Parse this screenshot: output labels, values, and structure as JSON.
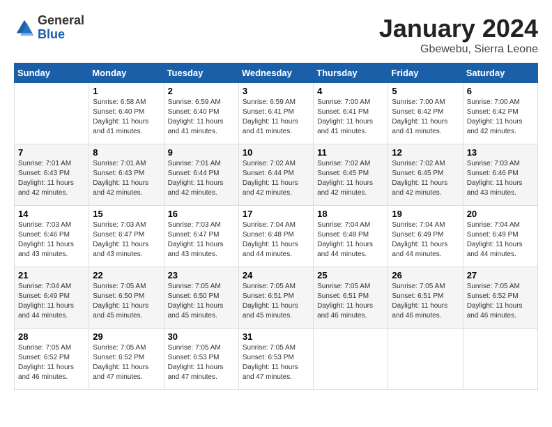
{
  "header": {
    "logo_general": "General",
    "logo_blue": "Blue",
    "month_title": "January 2024",
    "location": "Gbewebu, Sierra Leone"
  },
  "days_of_week": [
    "Sunday",
    "Monday",
    "Tuesday",
    "Wednesday",
    "Thursday",
    "Friday",
    "Saturday"
  ],
  "weeks": [
    [
      {
        "day": "",
        "sunrise": "",
        "sunset": "",
        "daylight": ""
      },
      {
        "day": "1",
        "sunrise": "Sunrise: 6:58 AM",
        "sunset": "Sunset: 6:40 PM",
        "daylight": "Daylight: 11 hours and 41 minutes."
      },
      {
        "day": "2",
        "sunrise": "Sunrise: 6:59 AM",
        "sunset": "Sunset: 6:40 PM",
        "daylight": "Daylight: 11 hours and 41 minutes."
      },
      {
        "day": "3",
        "sunrise": "Sunrise: 6:59 AM",
        "sunset": "Sunset: 6:41 PM",
        "daylight": "Daylight: 11 hours and 41 minutes."
      },
      {
        "day": "4",
        "sunrise": "Sunrise: 7:00 AM",
        "sunset": "Sunset: 6:41 PM",
        "daylight": "Daylight: 11 hours and 41 minutes."
      },
      {
        "day": "5",
        "sunrise": "Sunrise: 7:00 AM",
        "sunset": "Sunset: 6:42 PM",
        "daylight": "Daylight: 11 hours and 41 minutes."
      },
      {
        "day": "6",
        "sunrise": "Sunrise: 7:00 AM",
        "sunset": "Sunset: 6:42 PM",
        "daylight": "Daylight: 11 hours and 42 minutes."
      }
    ],
    [
      {
        "day": "7",
        "sunrise": "Sunrise: 7:01 AM",
        "sunset": "Sunset: 6:43 PM",
        "daylight": "Daylight: 11 hours and 42 minutes."
      },
      {
        "day": "8",
        "sunrise": "Sunrise: 7:01 AM",
        "sunset": "Sunset: 6:43 PM",
        "daylight": "Daylight: 11 hours and 42 minutes."
      },
      {
        "day": "9",
        "sunrise": "Sunrise: 7:01 AM",
        "sunset": "Sunset: 6:44 PM",
        "daylight": "Daylight: 11 hours and 42 minutes."
      },
      {
        "day": "10",
        "sunrise": "Sunrise: 7:02 AM",
        "sunset": "Sunset: 6:44 PM",
        "daylight": "Daylight: 11 hours and 42 minutes."
      },
      {
        "day": "11",
        "sunrise": "Sunrise: 7:02 AM",
        "sunset": "Sunset: 6:45 PM",
        "daylight": "Daylight: 11 hours and 42 minutes."
      },
      {
        "day": "12",
        "sunrise": "Sunrise: 7:02 AM",
        "sunset": "Sunset: 6:45 PM",
        "daylight": "Daylight: 11 hours and 42 minutes."
      },
      {
        "day": "13",
        "sunrise": "Sunrise: 7:03 AM",
        "sunset": "Sunset: 6:46 PM",
        "daylight": "Daylight: 11 hours and 43 minutes."
      }
    ],
    [
      {
        "day": "14",
        "sunrise": "Sunrise: 7:03 AM",
        "sunset": "Sunset: 6:46 PM",
        "daylight": "Daylight: 11 hours and 43 minutes."
      },
      {
        "day": "15",
        "sunrise": "Sunrise: 7:03 AM",
        "sunset": "Sunset: 6:47 PM",
        "daylight": "Daylight: 11 hours and 43 minutes."
      },
      {
        "day": "16",
        "sunrise": "Sunrise: 7:03 AM",
        "sunset": "Sunset: 6:47 PM",
        "daylight": "Daylight: 11 hours and 43 minutes."
      },
      {
        "day": "17",
        "sunrise": "Sunrise: 7:04 AM",
        "sunset": "Sunset: 6:48 PM",
        "daylight": "Daylight: 11 hours and 44 minutes."
      },
      {
        "day": "18",
        "sunrise": "Sunrise: 7:04 AM",
        "sunset": "Sunset: 6:48 PM",
        "daylight": "Daylight: 11 hours and 44 minutes."
      },
      {
        "day": "19",
        "sunrise": "Sunrise: 7:04 AM",
        "sunset": "Sunset: 6:49 PM",
        "daylight": "Daylight: 11 hours and 44 minutes."
      },
      {
        "day": "20",
        "sunrise": "Sunrise: 7:04 AM",
        "sunset": "Sunset: 6:49 PM",
        "daylight": "Daylight: 11 hours and 44 minutes."
      }
    ],
    [
      {
        "day": "21",
        "sunrise": "Sunrise: 7:04 AM",
        "sunset": "Sunset: 6:49 PM",
        "daylight": "Daylight: 11 hours and 44 minutes."
      },
      {
        "day": "22",
        "sunrise": "Sunrise: 7:05 AM",
        "sunset": "Sunset: 6:50 PM",
        "daylight": "Daylight: 11 hours and 45 minutes."
      },
      {
        "day": "23",
        "sunrise": "Sunrise: 7:05 AM",
        "sunset": "Sunset: 6:50 PM",
        "daylight": "Daylight: 11 hours and 45 minutes."
      },
      {
        "day": "24",
        "sunrise": "Sunrise: 7:05 AM",
        "sunset": "Sunset: 6:51 PM",
        "daylight": "Daylight: 11 hours and 45 minutes."
      },
      {
        "day": "25",
        "sunrise": "Sunrise: 7:05 AM",
        "sunset": "Sunset: 6:51 PM",
        "daylight": "Daylight: 11 hours and 46 minutes."
      },
      {
        "day": "26",
        "sunrise": "Sunrise: 7:05 AM",
        "sunset": "Sunset: 6:51 PM",
        "daylight": "Daylight: 11 hours and 46 minutes."
      },
      {
        "day": "27",
        "sunrise": "Sunrise: 7:05 AM",
        "sunset": "Sunset: 6:52 PM",
        "daylight": "Daylight: 11 hours and 46 minutes."
      }
    ],
    [
      {
        "day": "28",
        "sunrise": "Sunrise: 7:05 AM",
        "sunset": "Sunset: 6:52 PM",
        "daylight": "Daylight: 11 hours and 46 minutes."
      },
      {
        "day": "29",
        "sunrise": "Sunrise: 7:05 AM",
        "sunset": "Sunset: 6:52 PM",
        "daylight": "Daylight: 11 hours and 47 minutes."
      },
      {
        "day": "30",
        "sunrise": "Sunrise: 7:05 AM",
        "sunset": "Sunset: 6:53 PM",
        "daylight": "Daylight: 11 hours and 47 minutes."
      },
      {
        "day": "31",
        "sunrise": "Sunrise: 7:05 AM",
        "sunset": "Sunset: 6:53 PM",
        "daylight": "Daylight: 11 hours and 47 minutes."
      },
      {
        "day": "",
        "sunrise": "",
        "sunset": "",
        "daylight": ""
      },
      {
        "day": "",
        "sunrise": "",
        "sunset": "",
        "daylight": ""
      },
      {
        "day": "",
        "sunrise": "",
        "sunset": "",
        "daylight": ""
      }
    ]
  ]
}
